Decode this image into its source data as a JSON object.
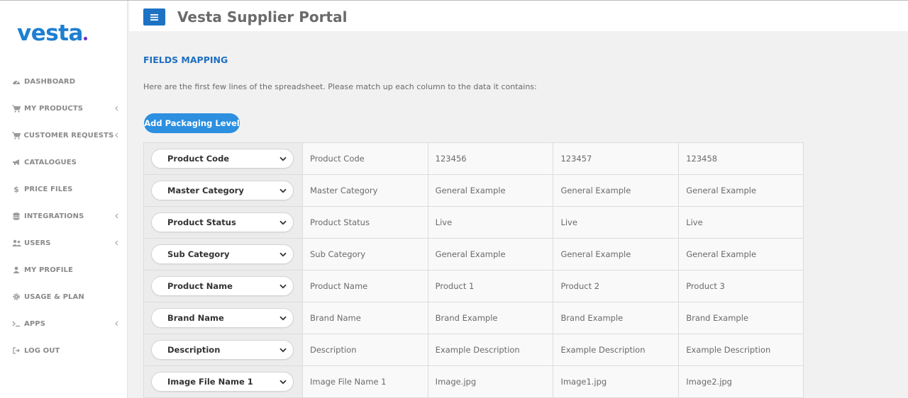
{
  "app": {
    "logo_text": "vesta",
    "title": "Vesta Supplier Portal",
    "colors": {
      "accent": "#1d72c4",
      "button": "#2c8fe0",
      "heading": "#1f6fbf",
      "logo_dot": "#6a2fc2"
    }
  },
  "sidebar": {
    "items": [
      {
        "label": "DASHBOARD",
        "icon": "dashboard-icon",
        "has_chevron": false
      },
      {
        "label": "MY PRODUCTS",
        "icon": "cart-icon",
        "has_chevron": true
      },
      {
        "label": "CUSTOMER REQUESTS",
        "icon": "cart-icon",
        "has_chevron": true
      },
      {
        "label": "CATALOGUES",
        "icon": "bullhorn-icon",
        "has_chevron": false
      },
      {
        "label": "PRICE FILES",
        "icon": "dollar-icon",
        "has_chevron": false
      },
      {
        "label": "INTEGRATIONS",
        "icon": "database-icon",
        "has_chevron": true
      },
      {
        "label": "USERS",
        "icon": "users-icon",
        "has_chevron": true
      },
      {
        "label": "MY PROFILE",
        "icon": "user-icon",
        "has_chevron": false
      },
      {
        "label": "USAGE & PLAN",
        "icon": "gear-icon",
        "has_chevron": false
      },
      {
        "label": "APPS",
        "icon": "terminal-icon",
        "has_chevron": true
      },
      {
        "label": "LOG OUT",
        "icon": "sign-out-icon",
        "has_chevron": false
      }
    ]
  },
  "main": {
    "section_title": "FIELDS MAPPING",
    "intro": "Here are the first few lines of the spreadsheet. Please match up each column to the data it contains:",
    "add_button": "Add Packaging Level",
    "rows": [
      {
        "selected": "Product Code",
        "cells": [
          "Product Code",
          "123456",
          "123457",
          "123458"
        ]
      },
      {
        "selected": "Master Category",
        "cells": [
          "Master Category",
          "General Example",
          "General Example",
          "General Example"
        ]
      },
      {
        "selected": "Product Status",
        "cells": [
          "Product Status",
          "Live",
          "Live",
          "Live"
        ]
      },
      {
        "selected": "Sub Category",
        "cells": [
          "Sub Category",
          "General Example",
          "General Example",
          "General Example"
        ]
      },
      {
        "selected": "Product Name",
        "cells": [
          "Product Name",
          "Product 1",
          "Product 2",
          "Product 3"
        ]
      },
      {
        "selected": "Brand Name",
        "cells": [
          "Brand Name",
          "Brand Example",
          "Brand Example",
          "Brand Example"
        ]
      },
      {
        "selected": "Description",
        "cells": [
          "Description",
          "Example Description",
          "Example Description",
          "Example Description"
        ]
      },
      {
        "selected": "Image File Name 1",
        "cells": [
          "Image File Name 1",
          "Image.jpg",
          "Image1.jpg",
          "Image2.jpg"
        ]
      }
    ]
  }
}
